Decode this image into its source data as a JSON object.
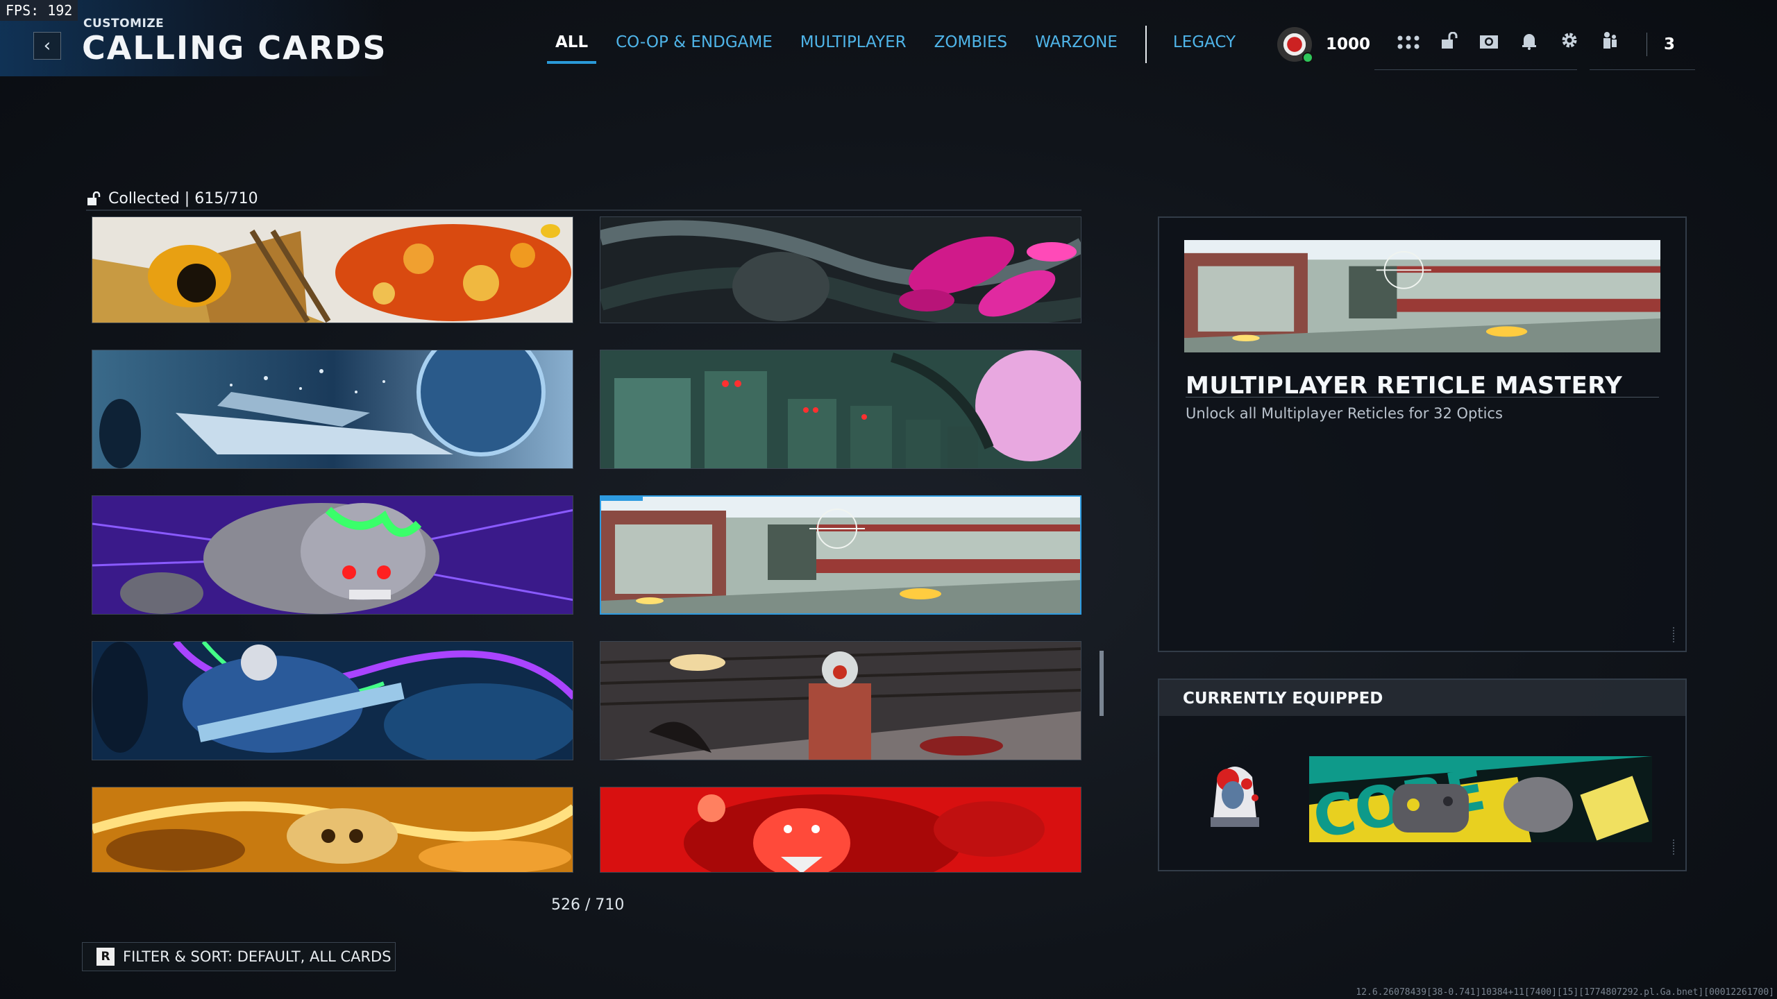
{
  "fps": "FPS:  192",
  "header": {
    "back_icon": "chevron-left-icon",
    "subtitle": "CUSTOMIZE",
    "title": "CALLING CARDS"
  },
  "nav": {
    "tabs": [
      {
        "label": "ALL",
        "active": true
      },
      {
        "label": "CO-OP & ENDGAME",
        "active": false
      },
      {
        "label": "MULTIPLAYER",
        "active": false
      },
      {
        "label": "ZOMBIES",
        "active": false
      },
      {
        "label": "WARZONE",
        "active": false
      }
    ],
    "legacy_tab": "LEGACY"
  },
  "hud": {
    "points": "1000",
    "icons": [
      "grid-dots-icon",
      "unlock-icon",
      "camera-icon",
      "bell-icon",
      "gear-icon",
      "party-icon"
    ],
    "party_count": "3"
  },
  "grid": {
    "collected_label": "Collected | 615/710",
    "position_label": "526 / 710",
    "cards": [
      {
        "name": "card-bee-honey",
        "selected": false
      },
      {
        "name": "card-dark-tentacles",
        "selected": false
      },
      {
        "name": "card-space-debris",
        "selected": false
      },
      {
        "name": "card-robot-soldiers",
        "selected": false
      },
      {
        "name": "card-zombie-skull",
        "selected": false
      },
      {
        "name": "card-multiplayer-reticle",
        "selected": true
      },
      {
        "name": "card-neon-skeleton",
        "selected": false
      },
      {
        "name": "card-gas-mask",
        "selected": false
      },
      {
        "name": "card-gold-skull",
        "selected": false
      },
      {
        "name": "card-red-beast",
        "selected": false
      }
    ]
  },
  "filter": {
    "key": "R",
    "label": "FILTER & SORT: DEFAULT, ALL CARDS"
  },
  "detail": {
    "title": "MULTIPLAYER RETICLE MASTERY",
    "description": "Unlock all Multiplayer Reticles for 32 Optics"
  },
  "equipped": {
    "title": "CURRENTLY EQUIPPED",
    "card_text": "CORE"
  },
  "build_string": "12.6.26078439[38-0.741]10384+11[7400][15][1774807292.pl.Ga.bnet][00012261700]",
  "colors": {
    "accent": "#2e9be0",
    "nav_inactive": "#4fb4e8",
    "background": "#10141a"
  }
}
